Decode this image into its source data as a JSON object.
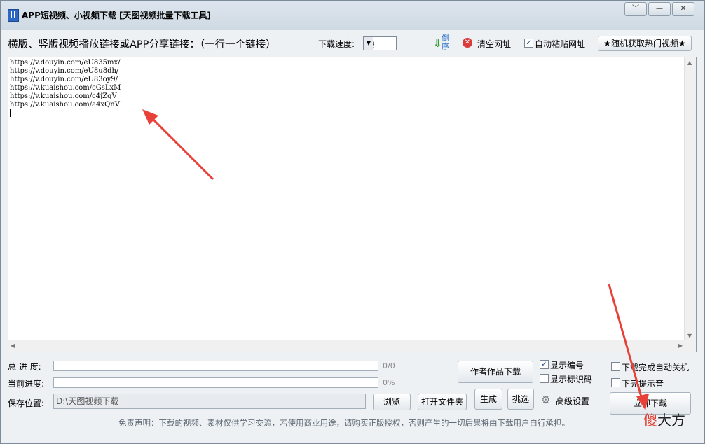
{
  "window": {
    "title": "APP短视频、小视频下载 [天图视频批量下载工具]"
  },
  "toolbar": {
    "input_label": "横版、竖版视频播放链接或APP分享链接：（一行一个链接）",
    "speed_label": "下载速度:",
    "speed_value": "快",
    "reverse_label": "倒序",
    "clear_label": "清空网址",
    "autopaste_label": "自动粘贴网址",
    "autopaste_checked": true,
    "random_hot_label": "★随机获取热门视频★"
  },
  "links": [
    "https://v.douyin.com/eU835mx/",
    "https://v.douyin.com/eU8u8dh/",
    "https://v.douyin.com/eU83oy9/",
    "https://v.kuaishou.com/cGsLxM",
    "https://v.kuaishou.com/c4jZqV",
    "https://v.kuaishou.com/a4xQnV"
  ],
  "progress": {
    "total_label": "总 进 度:",
    "total_value": "0/0",
    "total_fraction": 0,
    "current_label": "当前进度:",
    "current_value": "0%",
    "current_fraction": 0
  },
  "save": {
    "label": "保存位置:",
    "path": "D:\\天图视频下载",
    "browse_label": "浏览",
    "open_folder_label": "打开文件夹"
  },
  "buttons": {
    "author_download": "作者作品下载",
    "generate": "生成",
    "pick": "挑选",
    "advanced": "高级设置",
    "download_now": "立即下载"
  },
  "options": {
    "show_number": "显示编号",
    "show_number_checked": true,
    "show_id": "显示标识码",
    "show_id_checked": false,
    "auto_shutdown": "下载完成自动关机",
    "auto_shutdown_checked": false,
    "sound": "下完提示音",
    "sound_checked": false
  },
  "disclaimer": "免责声明：下载的视频、素材仅供学习交流，若使用商业用途，请购买正版授权，否则产生的一切后果将由下载用户自行承担。",
  "watermark": {
    "part1": "傻",
    "part2": "大方"
  },
  "colors": {
    "progress_fill": "#5aa0e0",
    "arrow": "#e8413a"
  }
}
